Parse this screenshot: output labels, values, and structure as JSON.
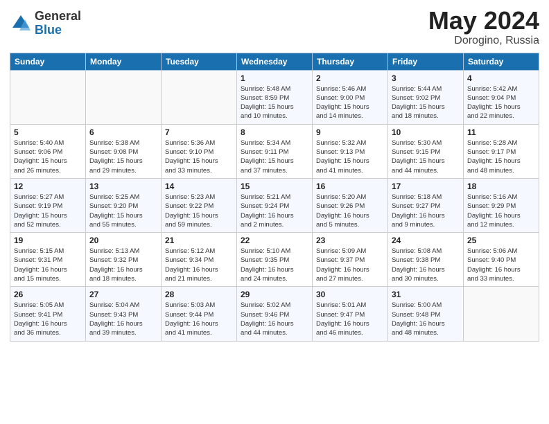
{
  "header": {
    "logo_general": "General",
    "logo_blue": "Blue",
    "title": "May 2024",
    "location": "Dorogino, Russia"
  },
  "weekdays": [
    "Sunday",
    "Monday",
    "Tuesday",
    "Wednesday",
    "Thursday",
    "Friday",
    "Saturday"
  ],
  "weeks": [
    [
      {
        "day": "",
        "info": ""
      },
      {
        "day": "",
        "info": ""
      },
      {
        "day": "",
        "info": ""
      },
      {
        "day": "1",
        "info": "Sunrise: 5:48 AM\nSunset: 8:59 PM\nDaylight: 15 hours\nand 10 minutes."
      },
      {
        "day": "2",
        "info": "Sunrise: 5:46 AM\nSunset: 9:00 PM\nDaylight: 15 hours\nand 14 minutes."
      },
      {
        "day": "3",
        "info": "Sunrise: 5:44 AM\nSunset: 9:02 PM\nDaylight: 15 hours\nand 18 minutes."
      },
      {
        "day": "4",
        "info": "Sunrise: 5:42 AM\nSunset: 9:04 PM\nDaylight: 15 hours\nand 22 minutes."
      }
    ],
    [
      {
        "day": "5",
        "info": "Sunrise: 5:40 AM\nSunset: 9:06 PM\nDaylight: 15 hours\nand 26 minutes."
      },
      {
        "day": "6",
        "info": "Sunrise: 5:38 AM\nSunset: 9:08 PM\nDaylight: 15 hours\nand 29 minutes."
      },
      {
        "day": "7",
        "info": "Sunrise: 5:36 AM\nSunset: 9:10 PM\nDaylight: 15 hours\nand 33 minutes."
      },
      {
        "day": "8",
        "info": "Sunrise: 5:34 AM\nSunset: 9:11 PM\nDaylight: 15 hours\nand 37 minutes."
      },
      {
        "day": "9",
        "info": "Sunrise: 5:32 AM\nSunset: 9:13 PM\nDaylight: 15 hours\nand 41 minutes."
      },
      {
        "day": "10",
        "info": "Sunrise: 5:30 AM\nSunset: 9:15 PM\nDaylight: 15 hours\nand 44 minutes."
      },
      {
        "day": "11",
        "info": "Sunrise: 5:28 AM\nSunset: 9:17 PM\nDaylight: 15 hours\nand 48 minutes."
      }
    ],
    [
      {
        "day": "12",
        "info": "Sunrise: 5:27 AM\nSunset: 9:19 PM\nDaylight: 15 hours\nand 52 minutes."
      },
      {
        "day": "13",
        "info": "Sunrise: 5:25 AM\nSunset: 9:20 PM\nDaylight: 15 hours\nand 55 minutes."
      },
      {
        "day": "14",
        "info": "Sunrise: 5:23 AM\nSunset: 9:22 PM\nDaylight: 15 hours\nand 59 minutes."
      },
      {
        "day": "15",
        "info": "Sunrise: 5:21 AM\nSunset: 9:24 PM\nDaylight: 16 hours\nand 2 minutes."
      },
      {
        "day": "16",
        "info": "Sunrise: 5:20 AM\nSunset: 9:26 PM\nDaylight: 16 hours\nand 5 minutes."
      },
      {
        "day": "17",
        "info": "Sunrise: 5:18 AM\nSunset: 9:27 PM\nDaylight: 16 hours\nand 9 minutes."
      },
      {
        "day": "18",
        "info": "Sunrise: 5:16 AM\nSunset: 9:29 PM\nDaylight: 16 hours\nand 12 minutes."
      }
    ],
    [
      {
        "day": "19",
        "info": "Sunrise: 5:15 AM\nSunset: 9:31 PM\nDaylight: 16 hours\nand 15 minutes."
      },
      {
        "day": "20",
        "info": "Sunrise: 5:13 AM\nSunset: 9:32 PM\nDaylight: 16 hours\nand 18 minutes."
      },
      {
        "day": "21",
        "info": "Sunrise: 5:12 AM\nSunset: 9:34 PM\nDaylight: 16 hours\nand 21 minutes."
      },
      {
        "day": "22",
        "info": "Sunrise: 5:10 AM\nSunset: 9:35 PM\nDaylight: 16 hours\nand 24 minutes."
      },
      {
        "day": "23",
        "info": "Sunrise: 5:09 AM\nSunset: 9:37 PM\nDaylight: 16 hours\nand 27 minutes."
      },
      {
        "day": "24",
        "info": "Sunrise: 5:08 AM\nSunset: 9:38 PM\nDaylight: 16 hours\nand 30 minutes."
      },
      {
        "day": "25",
        "info": "Sunrise: 5:06 AM\nSunset: 9:40 PM\nDaylight: 16 hours\nand 33 minutes."
      }
    ],
    [
      {
        "day": "26",
        "info": "Sunrise: 5:05 AM\nSunset: 9:41 PM\nDaylight: 16 hours\nand 36 minutes."
      },
      {
        "day": "27",
        "info": "Sunrise: 5:04 AM\nSunset: 9:43 PM\nDaylight: 16 hours\nand 39 minutes."
      },
      {
        "day": "28",
        "info": "Sunrise: 5:03 AM\nSunset: 9:44 PM\nDaylight: 16 hours\nand 41 minutes."
      },
      {
        "day": "29",
        "info": "Sunrise: 5:02 AM\nSunset: 9:46 PM\nDaylight: 16 hours\nand 44 minutes."
      },
      {
        "day": "30",
        "info": "Sunrise: 5:01 AM\nSunset: 9:47 PM\nDaylight: 16 hours\nand 46 minutes."
      },
      {
        "day": "31",
        "info": "Sunrise: 5:00 AM\nSunset: 9:48 PM\nDaylight: 16 hours\nand 48 minutes."
      },
      {
        "day": "",
        "info": ""
      }
    ]
  ]
}
